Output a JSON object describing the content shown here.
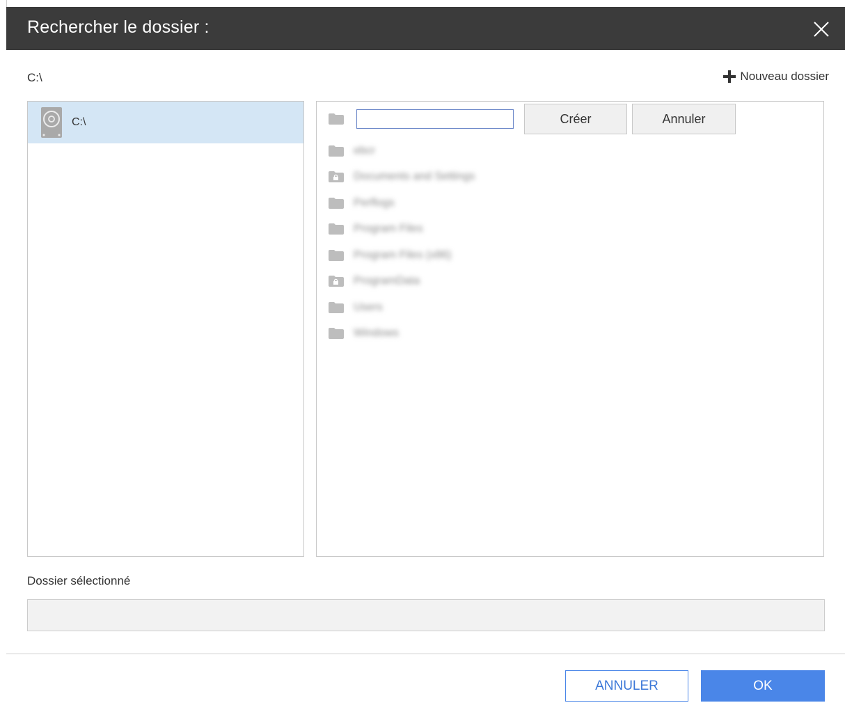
{
  "dialog": {
    "title": "Rechercher le dossier :",
    "current_path": "C:\\",
    "new_folder_label": "Nouveau dossier"
  },
  "tree": {
    "items": [
      {
        "label": "C:\\",
        "icon": "hard-drive-icon",
        "selected": true
      }
    ]
  },
  "new_folder_row": {
    "input_value": "",
    "create_label": "Créer",
    "cancel_label": "Annuler"
  },
  "folders": [
    {
      "name": "ebcr",
      "locked": false
    },
    {
      "name": "Documents and Settings",
      "locked": true
    },
    {
      "name": "Perflogs",
      "locked": false
    },
    {
      "name": "Program Files",
      "locked": false
    },
    {
      "name": "Program Files (x86)",
      "locked": false
    },
    {
      "name": "ProgramData",
      "locked": true
    },
    {
      "name": "Users",
      "locked": false
    },
    {
      "name": "Windows",
      "locked": false
    }
  ],
  "selected_folder": {
    "label": "Dossier sélectionné",
    "value": ""
  },
  "footer": {
    "cancel_label": "ANNULER",
    "ok_label": "OK"
  },
  "colors": {
    "titlebar": "#3b3b3b",
    "selection": "#d4e6f5",
    "accent": "#4a86e8",
    "folder_icon": "#bdbdbd"
  }
}
